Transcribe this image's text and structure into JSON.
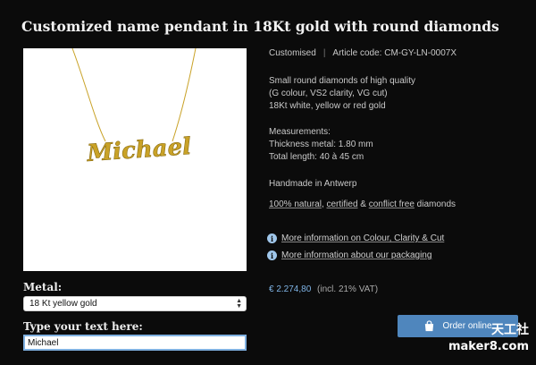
{
  "product": {
    "title": "Customized name pendant in 18Kt gold with round diamonds",
    "image_text": "Michael"
  },
  "meta": {
    "category": "Customised",
    "separator": "|",
    "article_code": "Article code: CM-GY-LN-0007X"
  },
  "description": {
    "line1": "Small round diamonds of high quality",
    "line2": "(G colour, VS2 clarity, VG cut)",
    "line3": "18Kt white, yellow or red gold"
  },
  "measurements": {
    "heading": "Measurements:",
    "thickness": "Thickness metal: 1.80 mm",
    "length": "Total length: 40 à 45 cm"
  },
  "handmade": "Handmade in Antwerp",
  "features": {
    "natural": "100% natural",
    "sep1": ", ",
    "certified": "certified",
    "sep2": " & ",
    "conflict_free": "conflict free",
    "suffix": " diamonds"
  },
  "links": {
    "colour_clarity": "More information on Colour, Clarity & Cut",
    "packaging": "More information about our packaging"
  },
  "price": {
    "amount": "€ 2.274,80",
    "vat": "(incl. 21% VAT)"
  },
  "form": {
    "metal_label": "Metal:",
    "metal_selected": "18 Kt yellow gold",
    "text_label": "Type your text here:",
    "text_value": "Michael"
  },
  "order_button": "Order online",
  "watermark": {
    "top": "天工社",
    "bottom": "maker8.com"
  },
  "colors": {
    "background": "#0b0b0b",
    "accent": "#4f86bd",
    "price": "#7fb4e6",
    "gold": "#c9a227"
  },
  "icons": {
    "info": "info-icon",
    "bag": "shopping-bag-icon",
    "select_arrows": "select-arrows-icon"
  }
}
